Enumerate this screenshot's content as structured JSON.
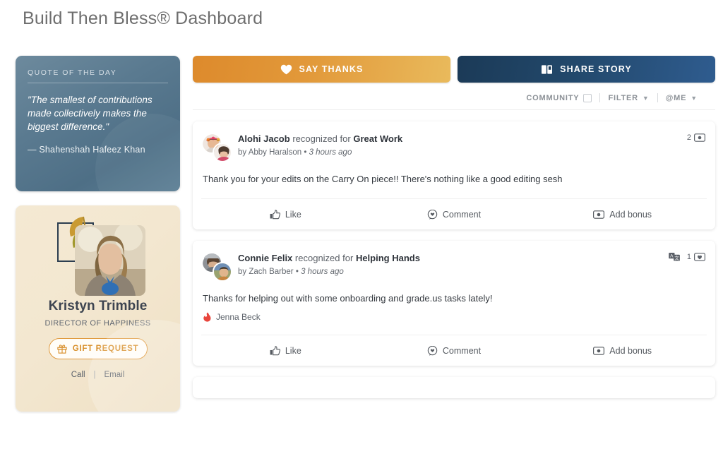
{
  "header": {
    "title": "Build Then Bless® Dashboard"
  },
  "colors": {
    "thanks_start": "#dd8a2c",
    "thanks_end": "#e9ba5c",
    "story_start": "#1b3a57",
    "story_end": "#2f5c8f",
    "quote_card_bg": "#5a7a90",
    "profile_card_bg": "#f3e7d0",
    "gift_accent": "#d88f2a",
    "flame": "#e8453c"
  },
  "quote_card": {
    "label": "QUOTE OF THE DAY",
    "text": "\"The smallest of contributions made collectively makes the biggest difference.\"",
    "author": "— Shahenshah Hafeez Khan"
  },
  "profile_card": {
    "name": "Kristyn Trimble",
    "role": "DIRECTOR OF HAPPINESS",
    "gift_button": "GIFT REQUEST",
    "gift_icon": "gift-icon",
    "call_link": "Call",
    "separator": "|",
    "email_link": "Email"
  },
  "actions": {
    "say_thanks": {
      "label": "SAY THANKS",
      "icon": "heart-icon"
    },
    "share_story": {
      "label": "SHARE STORY",
      "icon": "book-icon"
    }
  },
  "filter_bar": {
    "community_label": "COMMUNITY",
    "community_checked": false,
    "filter_label": "FILTER",
    "me_label": "@ME",
    "caret_icon": "chevron-down-icon"
  },
  "feed": {
    "posts": [
      {
        "recipient": "Alohi Jacob",
        "connector": "recognized for",
        "value": "Great Work",
        "byline_prefix": "by",
        "sender": "Abby Haralson",
        "dot": "•",
        "time": "3 hours ago",
        "body": "Thank you for your edits on the Carry On piece!! There's nothing like a good editing sesh",
        "bonus_count": "2",
        "bonus_icon": "money-bill-icon",
        "has_translate": false,
        "reactions": [],
        "actions": [
          {
            "label": "Like",
            "icon": "thumbs-up-icon"
          },
          {
            "label": "Comment",
            "icon": "comment-icon"
          },
          {
            "label": "Add bonus",
            "icon": "money-bill-icon"
          }
        ]
      },
      {
        "recipient": "Connie Felix",
        "connector": "recognized for",
        "value": "Helping Hands",
        "byline_prefix": "by",
        "sender": "Zach Barber",
        "dot": "•",
        "time": "3 hours ago",
        "body": "Thanks for helping out with some onboarding and grade.us tasks lately!",
        "bonus_count": "1",
        "bonus_icon": "money-bill-heart-icon",
        "has_translate": true,
        "translate_icon": "translate-icon",
        "reactions": [
          {
            "icon": "flame-icon",
            "name": "Jenna Beck"
          }
        ],
        "actions": [
          {
            "label": "Like",
            "icon": "thumbs-up-icon"
          },
          {
            "label": "Comment",
            "icon": "comment-icon"
          },
          {
            "label": "Add bonus",
            "icon": "money-bill-icon"
          }
        ]
      }
    ]
  }
}
